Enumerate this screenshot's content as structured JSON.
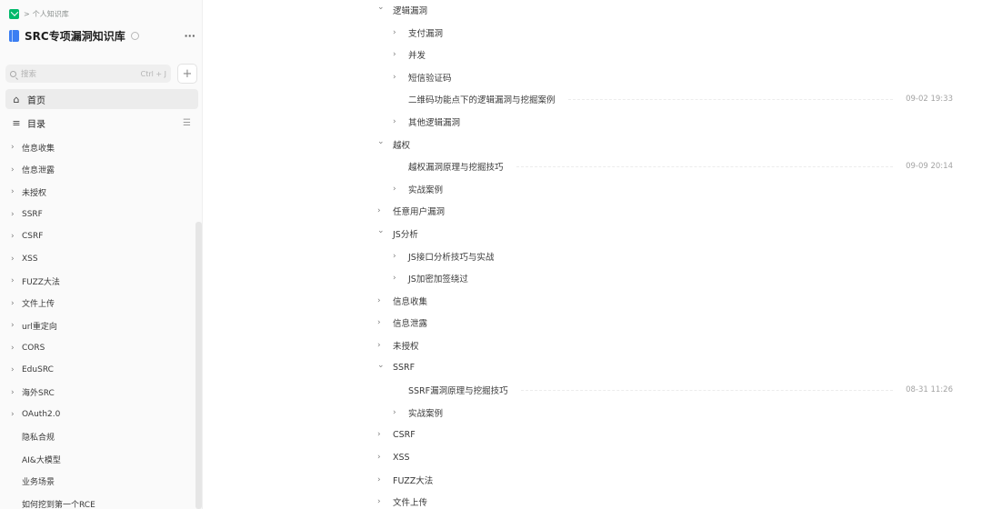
{
  "breadcrumb": {
    "separator": ">",
    "text": "个人知识库"
  },
  "kb": {
    "name": "SRC专项漏洞知识库",
    "more": "···"
  },
  "search": {
    "placeholder": "搜索",
    "shortcut": "Ctrl + J",
    "add": "+"
  },
  "nav": {
    "home": "首页",
    "toc": "目录"
  },
  "sidebar_tree": [
    {
      "label": "信息收集",
      "expandable": true
    },
    {
      "label": "信息泄露",
      "expandable": true
    },
    {
      "label": "未授权",
      "expandable": true
    },
    {
      "label": "SSRF",
      "expandable": true
    },
    {
      "label": "CSRF",
      "expandable": true
    },
    {
      "label": "XSS",
      "expandable": true
    },
    {
      "label": "FUZZ大法",
      "expandable": true
    },
    {
      "label": "文件上传",
      "expandable": true
    },
    {
      "label": "url重定向",
      "expandable": true
    },
    {
      "label": "CORS",
      "expandable": true
    },
    {
      "label": "EduSRC",
      "expandable": true
    },
    {
      "label": "海外SRC",
      "expandable": true
    },
    {
      "label": "OAuth2.0",
      "expandable": true
    },
    {
      "label": "隐私合规",
      "expandable": false
    },
    {
      "label": "AI&大模型",
      "expandable": false
    },
    {
      "label": "业务场景",
      "expandable": false
    },
    {
      "label": "如何挖到第一个RCE",
      "expandable": false
    }
  ],
  "main_tree": [
    {
      "label": "逻辑漏洞",
      "level": 0,
      "state": "expanded"
    },
    {
      "label": "支付漏洞",
      "level": 1,
      "state": "collapsed"
    },
    {
      "label": "并发",
      "level": 1,
      "state": "collapsed"
    },
    {
      "label": "短信验证码",
      "level": 1,
      "state": "collapsed"
    },
    {
      "label": "二维码功能点下的逻辑漏洞与挖掘案例",
      "level": 1,
      "state": "doc",
      "time": "09-02 19:33"
    },
    {
      "label": "其他逻辑漏洞",
      "level": 1,
      "state": "collapsed"
    },
    {
      "label": "越权",
      "level": 0,
      "state": "expanded"
    },
    {
      "label": "越权漏洞原理与挖掘技巧",
      "level": 1,
      "state": "doc",
      "time": "09-09 20:14"
    },
    {
      "label": "实战案例",
      "level": 1,
      "state": "collapsed"
    },
    {
      "label": "任意用户漏洞",
      "level": 0,
      "state": "collapsed"
    },
    {
      "label": "JS分析",
      "level": 0,
      "state": "expanded"
    },
    {
      "label": "JS接口分析技巧与实战",
      "level": 1,
      "state": "collapsed"
    },
    {
      "label": "JS加密加签绕过",
      "level": 1,
      "state": "collapsed"
    },
    {
      "label": "信息收集",
      "level": 0,
      "state": "collapsed"
    },
    {
      "label": "信息泄露",
      "level": 0,
      "state": "collapsed"
    },
    {
      "label": "未授权",
      "level": 0,
      "state": "collapsed"
    },
    {
      "label": "SSRF",
      "level": 0,
      "state": "expanded"
    },
    {
      "label": "SSRF漏洞原理与挖掘技巧",
      "level": 1,
      "state": "doc",
      "time": "08-31 11:26"
    },
    {
      "label": "实战案例",
      "level": 1,
      "state": "collapsed"
    },
    {
      "label": "CSRF",
      "level": 0,
      "state": "collapsed"
    },
    {
      "label": "XSS",
      "level": 0,
      "state": "collapsed"
    },
    {
      "label": "FUZZ大法",
      "level": 0,
      "state": "collapsed"
    },
    {
      "label": "文件上传",
      "level": 0,
      "state": "collapsed"
    }
  ]
}
